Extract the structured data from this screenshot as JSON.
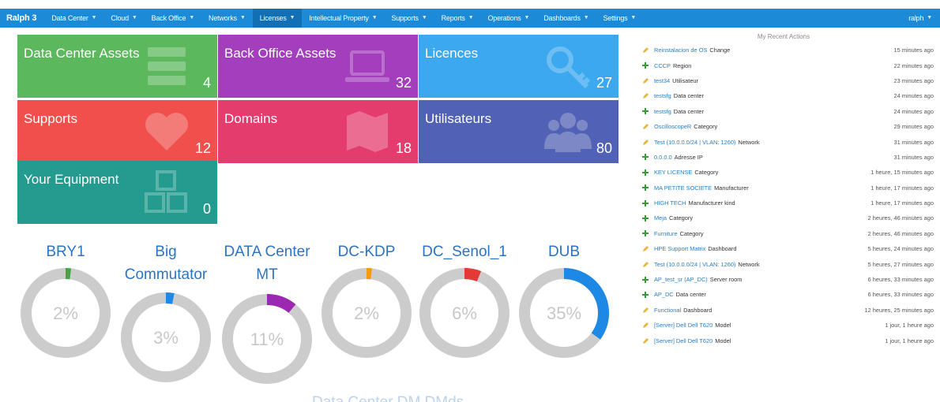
{
  "nav": {
    "brand": "Ralph 3",
    "items": [
      {
        "label": "Data Center",
        "active": false
      },
      {
        "label": "Cloud",
        "active": false
      },
      {
        "label": "Back Office",
        "active": false
      },
      {
        "label": "Networks",
        "active": false
      },
      {
        "label": "Licenses",
        "active": true
      },
      {
        "label": "Intellectual Property",
        "active": false
      },
      {
        "label": "Supports",
        "active": false
      },
      {
        "label": "Reports",
        "active": false
      },
      {
        "label": "Operations",
        "active": false
      },
      {
        "label": "Dashboards",
        "active": false
      },
      {
        "label": "Settings",
        "active": false
      }
    ],
    "user": "ralph",
    "bar_color": "#1d8ad8"
  },
  "tiles": [
    {
      "title": "Data Center Assets",
      "count": "4",
      "color": "#5cb85c",
      "icon": "server-icon"
    },
    {
      "title": "Back Office Assets",
      "count": "32",
      "color": "#a33ebd",
      "icon": "laptop-icon"
    },
    {
      "title": "Licences",
      "count": "27",
      "color": "#3ba8ef",
      "icon": "key-icon"
    },
    {
      "title": "Supports",
      "count": "12",
      "color": "#f04f4b",
      "icon": "heartbeat-icon"
    },
    {
      "title": "Domains",
      "count": "18",
      "color": "#e53c6e",
      "icon": "map-icon"
    },
    {
      "title": "Utilisateurs",
      "count": "80",
      "color": "#5161b5",
      "icon": "users-icon"
    },
    {
      "title": "Your Equipment",
      "count": "0",
      "color": "#239b8e",
      "icon": "cubes-icon"
    }
  ],
  "gauges": [
    {
      "title": "BRY1",
      "value": 2,
      "label": "2%",
      "color": "#47a447"
    },
    {
      "title": "Big Commutator",
      "value": 3,
      "label": "3%",
      "color": "#1e88e5"
    },
    {
      "title": "DATA Center MT",
      "value": 11,
      "label": "11%",
      "color": "#9c27b0"
    },
    {
      "title": "DC-KDP",
      "value": 2,
      "label": "2%",
      "color": "#f39c12"
    },
    {
      "title": "DC_Senol_1",
      "value": 6,
      "label": "6%",
      "color": "#e53935"
    },
    {
      "title": "DUB",
      "value": 35,
      "label": "35%",
      "color": "#1e88e5"
    }
  ],
  "gauge_track_color": "#cccccc",
  "bottom_faded_text": "Data Center   DM   DMds",
  "recent": {
    "title": "My Recent Actions",
    "items": [
      {
        "type": "edit",
        "link": "Reinstalacion de OS",
        "text": "Change",
        "time": "15 minutes ago"
      },
      {
        "type": "add",
        "link": "CCCP",
        "text": "Region",
        "time": "22 minutes ago"
      },
      {
        "type": "edit",
        "link": "test34",
        "text": "Utilisateur",
        "time": "23 minutes ago"
      },
      {
        "type": "edit",
        "link": "testsfg",
        "text": "Data center",
        "time": "24 minutes ago"
      },
      {
        "type": "add",
        "link": "testsfg",
        "text": "Data center",
        "time": "24 minutes ago"
      },
      {
        "type": "edit",
        "link": "OscilloscopeR",
        "text": "Category",
        "time": "29 minutes ago"
      },
      {
        "type": "edit",
        "link": "Test (10.0.0.0/24 | VLAN: 1260)",
        "text": "Network",
        "time": "31 minutes ago"
      },
      {
        "type": "add",
        "link": "0.0.0.0",
        "text": "Adresse IP",
        "time": "31 minutes ago"
      },
      {
        "type": "add",
        "link": "KEY LICENSE",
        "text": "Category",
        "time": "1 heure, 15 minutes ago"
      },
      {
        "type": "add",
        "link": "MA PETITE SOCIETE",
        "text": "Manufacturer",
        "time": "1 heure, 17 minutes ago"
      },
      {
        "type": "add",
        "link": "HIGH TECH",
        "text": "Manufacturer kind",
        "time": "1 heure, 17 minutes ago"
      },
      {
        "type": "add",
        "link": "Meja",
        "text": "Category",
        "time": "2 heures, 46 minutes ago"
      },
      {
        "type": "add",
        "link": "Furniture",
        "text": "Category",
        "time": "2 heures, 46 minutes ago"
      },
      {
        "type": "edit",
        "link": "HPE Support Matrix",
        "text": "Dashboard",
        "time": "5 heures, 24 minutes ago"
      },
      {
        "type": "edit",
        "link": "Test (10.0.0.0/24 | VLAN: 1260)",
        "text": "Network",
        "time": "5 heures, 27 minutes ago"
      },
      {
        "type": "add",
        "link": "AP_test_sr (AP_DC)",
        "text": "Server room",
        "time": "6 heures, 33 minutes ago"
      },
      {
        "type": "add",
        "link": "AP_DC",
        "text": "Data center",
        "time": "6 heures, 33 minutes ago"
      },
      {
        "type": "edit",
        "link": "Functional",
        "text": "Dashboard",
        "time": "12 heures, 25 minutes ago"
      },
      {
        "type": "edit",
        "link": "[Server] Dell Dell T620",
        "text": "Model",
        "time": "1 jour, 1 heure ago"
      },
      {
        "type": "edit",
        "link": "[Server] Dell Dell T620",
        "text": "Model",
        "time": "1 jour, 1 heure ago"
      }
    ]
  }
}
